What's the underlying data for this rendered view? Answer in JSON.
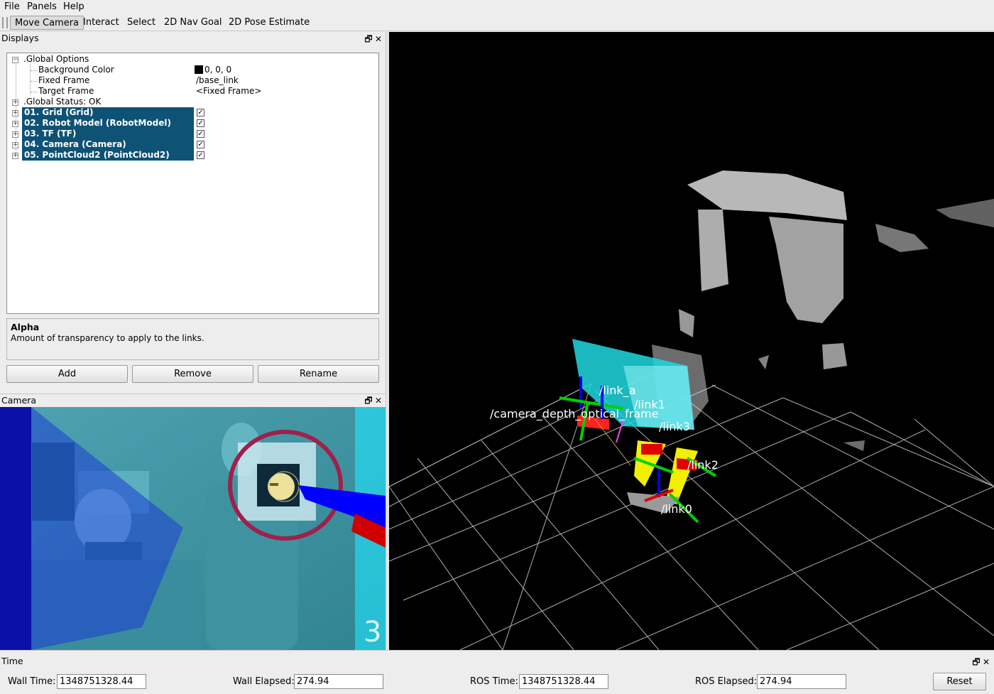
{
  "menubar": {
    "items": [
      {
        "label": "File"
      },
      {
        "label": "Panels"
      },
      {
        "label": "Help"
      }
    ]
  },
  "toolbar": {
    "tools": [
      {
        "label": "Move Camera",
        "active": true
      },
      {
        "label": "Interact"
      },
      {
        "label": "Select"
      },
      {
        "label": "2D Nav Goal"
      },
      {
        "label": "2D Pose Estimate"
      }
    ]
  },
  "displays_panel": {
    "title": "Displays",
    "tree": {
      "global_options": {
        "label": ".Global Options",
        "background_color": {
          "name": "Background Color",
          "value": "0, 0, 0",
          "color": "#000000"
        },
        "fixed_frame": {
          "name": "Fixed Frame",
          "value": "/base_link"
        },
        "target_frame": {
          "name": "Target Frame",
          "value": "<Fixed Frame>"
        }
      },
      "global_status": ".Global Status: OK",
      "displays": [
        {
          "label": "01. Grid (Grid)",
          "checked": true
        },
        {
          "label": "02. Robot Model (RobotModel)",
          "checked": true
        },
        {
          "label": "03. TF (TF)",
          "checked": true
        },
        {
          "label": "04. Camera (Camera)",
          "checked": true
        },
        {
          "label": "05. PointCloud2 (PointCloud2)",
          "checked": true
        }
      ]
    },
    "description": {
      "title": "Alpha",
      "text": "Amount of transparency to apply to the links."
    },
    "buttons": {
      "add": "Add",
      "remove": "Remove",
      "rename": "Rename"
    },
    "selection_color": "#0e5275"
  },
  "camera_panel": {
    "title": "Camera"
  },
  "view3d": {
    "labels": {
      "camera_frames": "/camera_depth_optical_frame",
      "link_a": "/link_a",
      "link1": "/link1",
      "link3": "/link3",
      "link2": "/link2",
      "link0": "/link0"
    }
  },
  "time_panel": {
    "title": "Time",
    "wall_time": {
      "label": "Wall Time:",
      "value": "1348751328.44"
    },
    "wall_elapsed": {
      "label": "Wall Elapsed:",
      "value": "274.94"
    },
    "ros_time": {
      "label": "ROS Time:",
      "value": "1348751328.44"
    },
    "ros_elapsed": {
      "label": "ROS Elapsed:",
      "value": "274.94"
    },
    "reset": "Reset"
  },
  "panel_controls": {
    "float": "🗗",
    "close": "✕"
  }
}
